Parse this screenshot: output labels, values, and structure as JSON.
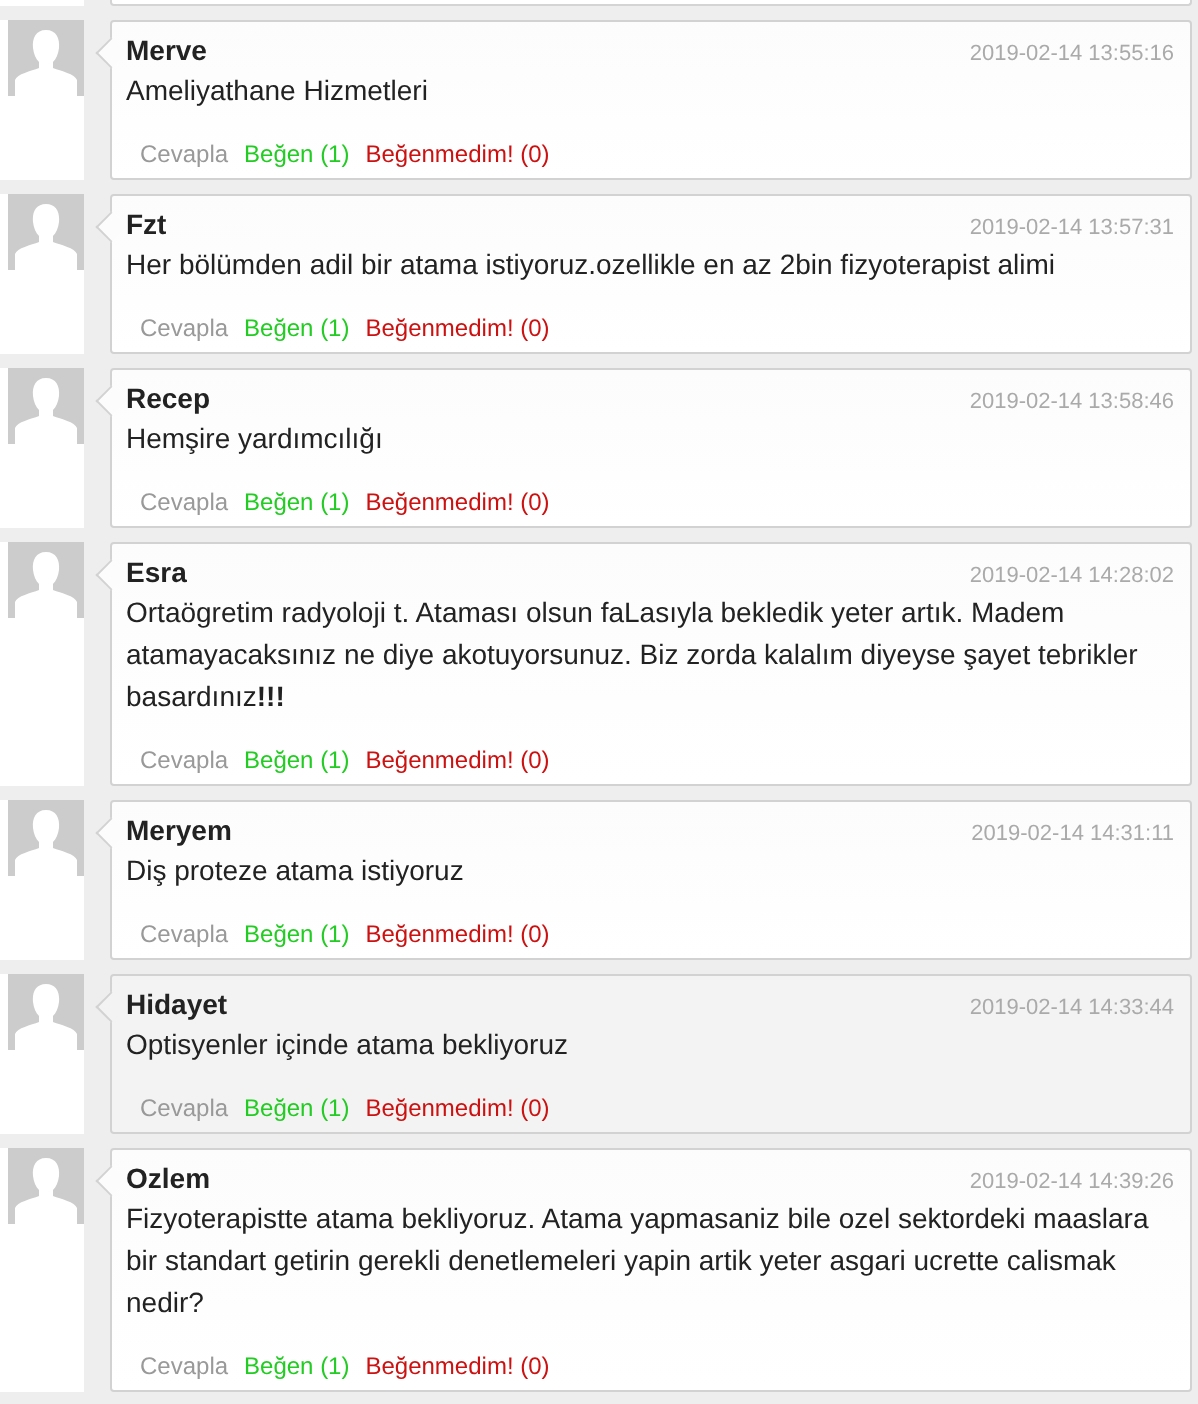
{
  "comments": [
    {
      "author": "Merve",
      "time": "2019-02-14 13:55:16",
      "text": "Ameliyathane Hizmetleri",
      "highlighted": false,
      "actions": [
        {
          "kind": "reply",
          "label": "Cevapla"
        },
        {
          "kind": "like",
          "label": "Beğen (1)"
        },
        {
          "kind": "dislike",
          "label": "Beğenmedim! (0)"
        }
      ]
    },
    {
      "author": "Fzt",
      "time": "2019-02-14 13:57:31",
      "text": "Her bölümden adil bir atama istiyoruz.ozellikle en az 2bin fizyoterapist alimi",
      "highlighted": false,
      "actions": [
        {
          "kind": "reply",
          "label": "Cevapla"
        },
        {
          "kind": "like",
          "label": "Beğen (1)"
        },
        {
          "kind": "dislike",
          "label": "Beğenmedim! (0)"
        }
      ]
    },
    {
      "author": "Recep",
      "time": "2019-02-14 13:58:46",
      "text": "Hemşire yardımcılığı",
      "highlighted": false,
      "actions": [
        {
          "kind": "reply",
          "label": "Cevapla"
        },
        {
          "kind": "like",
          "label": "Beğen (1)"
        },
        {
          "kind": "dislike",
          "label": "Beğenmedim! (0)"
        }
      ]
    },
    {
      "author": "Esra",
      "time": "2019-02-14 14:28:02",
      "text": "Ortaögretim radyoloji t. Ataması olsun faLasıyla bekledik yeter artık. Madem atamayacaksınız ne diye akotuyorsunuz. Biz zorda kalalım diyeyse şayet tebrikler basardınız**!!!**",
      "highlighted": false,
      "actions": [
        {
          "kind": "reply",
          "label": "Cevapla"
        },
        {
          "kind": "like",
          "label": "Beğen (1)"
        },
        {
          "kind": "dislike",
          "label": "Beğenmedim! (0)"
        }
      ]
    },
    {
      "author": "Meryem",
      "time": "2019-02-14 14:31:11",
      "text": "Diş proteze atama istiyoruz",
      "highlighted": false,
      "actions": [
        {
          "kind": "reply",
          "label": "Cevapla"
        },
        {
          "kind": "like",
          "label": "Beğen (1)"
        },
        {
          "kind": "dislike",
          "label": "Beğenmedim! (0)"
        }
      ]
    },
    {
      "author": "Hidayet",
      "time": "2019-02-14 14:33:44",
      "text": "Optisyenler içinde atama bekliyoruz",
      "highlighted": true,
      "actions": [
        {
          "kind": "reply",
          "label": "Cevapla"
        },
        {
          "kind": "like",
          "label": "Beğen (1)"
        },
        {
          "kind": "dislike",
          "label": "Beğenmedim! (0)"
        }
      ]
    },
    {
      "author": "Ozlem",
      "time": "2019-02-14 14:39:26",
      "text": "Fizyoterapistte atama bekliyoruz. Atama yapmasaniz bile ozel sektordeki maaslara bir standart getirin gerekli denetlemeleri yapin artik yeter asgari ucrette calismak nedir?",
      "highlighted": false,
      "actions": [
        {
          "kind": "reply",
          "label": "Cevapla"
        },
        {
          "kind": "like",
          "label": "Beğen (1)"
        },
        {
          "kind": "dislike",
          "label": "Beğenmedim! (0)"
        }
      ]
    }
  ]
}
